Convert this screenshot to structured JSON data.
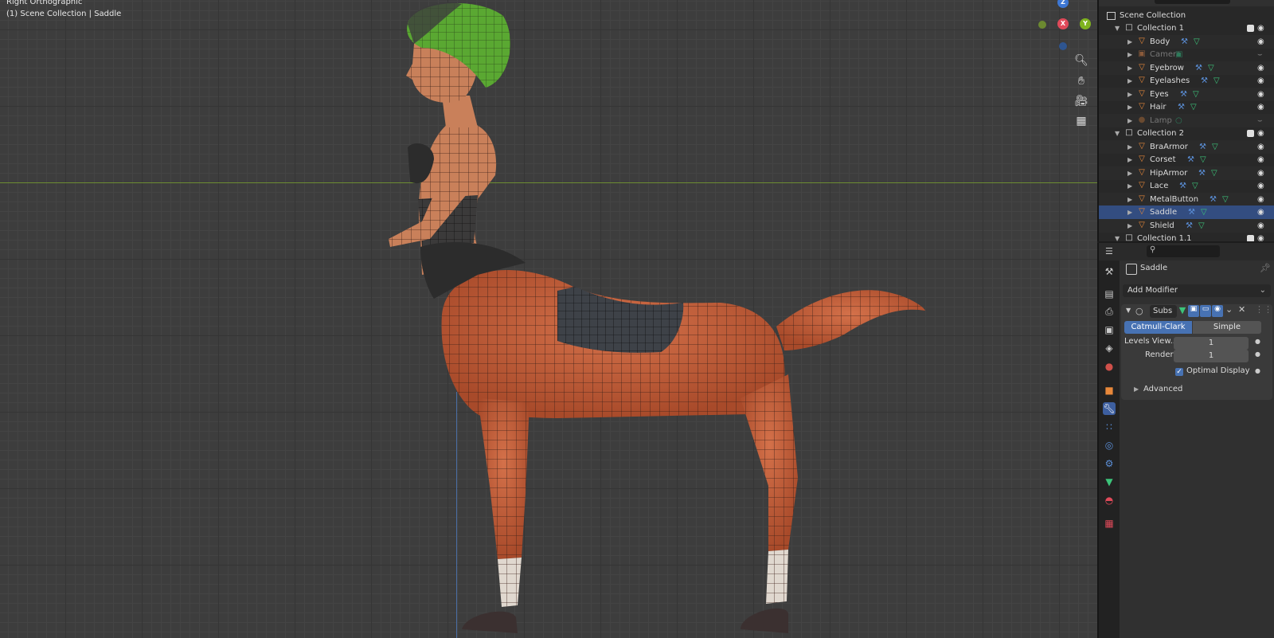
{
  "viewport": {
    "view_name": "Right Orthographic",
    "context": "(1) Scene Collection | Saddle",
    "gizmo": {
      "z": "Z",
      "y": "Y",
      "x": "X"
    }
  },
  "outliner": {
    "scene": "Scene Collection",
    "rows": [
      {
        "label": "Collection 1",
        "type": "collection"
      },
      {
        "label": "Body",
        "type": "mesh"
      },
      {
        "label": "Camera",
        "type": "camera"
      },
      {
        "label": "Eyebrow",
        "type": "mesh"
      },
      {
        "label": "Eyelashes",
        "type": "mesh"
      },
      {
        "label": "Eyes",
        "type": "mesh"
      },
      {
        "label": "Hair",
        "type": "mesh"
      },
      {
        "label": "Lamp",
        "type": "lamp"
      },
      {
        "label": "Collection 2",
        "type": "collection"
      },
      {
        "label": "BraArmor",
        "type": "mesh"
      },
      {
        "label": "Corset",
        "type": "mesh"
      },
      {
        "label": "HipArmor",
        "type": "mesh"
      },
      {
        "label": "Lace",
        "type": "mesh"
      },
      {
        "label": "MetalButton",
        "type": "mesh"
      },
      {
        "label": "Saddle",
        "type": "mesh"
      },
      {
        "label": "Shield",
        "type": "mesh"
      },
      {
        "label": "Collection 1.1",
        "type": "collection"
      }
    ]
  },
  "properties": {
    "object_name": "Saddle",
    "add_modifier": "Add Modifier",
    "modifier_name": "Subs",
    "catmull": "Catmull-Clark",
    "simple": "Simple",
    "levels_label": "Levels View...",
    "levels_value": "1",
    "render_label": "Render",
    "render_value": "1",
    "optimal_display": "Optimal Display",
    "advanced": "Advanced"
  },
  "colors": {
    "accent": "#4772b3",
    "mesh_icon": "#e8883a",
    "skin": "#c8603a",
    "hair": "#5aa832"
  }
}
